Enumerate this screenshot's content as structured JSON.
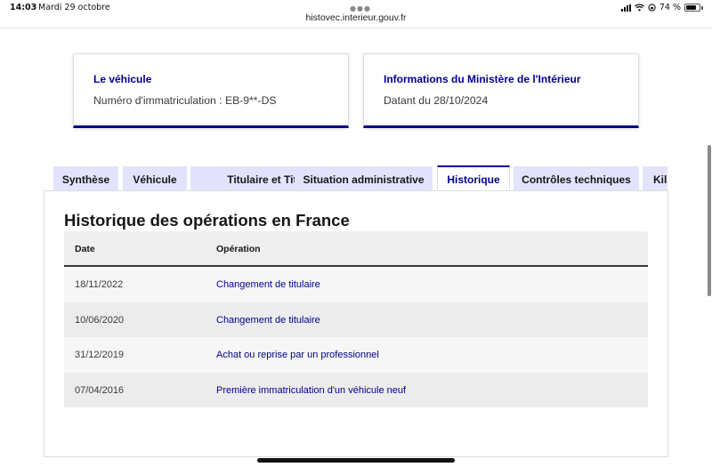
{
  "status_bar": {
    "time": "14:03",
    "date": "Mardi 29 octobre",
    "battery": "74 %"
  },
  "url": "histovec.interieur.gouv.fr",
  "cards": {
    "vehicle": {
      "title": "Le véhicule",
      "text": "Numéro d'immatriculation : EB-9**-DS"
    },
    "ministry": {
      "title": "Informations du Ministère de l'Intérieur",
      "text": "Datant du 28/10/2024"
    }
  },
  "tabs": [
    {
      "label": "Synthèse",
      "active": false
    },
    {
      "label": "Véhicule",
      "active": false
    },
    {
      "label": "Titulaire et Titre",
      "active": false
    },
    {
      "label": "Situation administrative",
      "active": false
    },
    {
      "label": "Historique",
      "active": true
    },
    {
      "label": "Contrôles techniques",
      "active": false
    },
    {
      "label": "Kil",
      "active": false
    }
  ],
  "history": {
    "title": "Historique des opérations en France",
    "columns": {
      "date": "Date",
      "operation": "Opération"
    },
    "rows": [
      {
        "date": "18/11/2022",
        "operation": "Changement de titulaire"
      },
      {
        "date": "10/06/2020",
        "operation": "Changement de titulaire"
      },
      {
        "date": "31/12/2019",
        "operation": "Achat ou reprise par un professionnel"
      },
      {
        "date": "07/04/2016",
        "operation": "Première immatriculation d'un véhicule neuf"
      }
    ]
  },
  "colors": {
    "accent": "#000091",
    "tab_bg": "#e3e3fd"
  }
}
